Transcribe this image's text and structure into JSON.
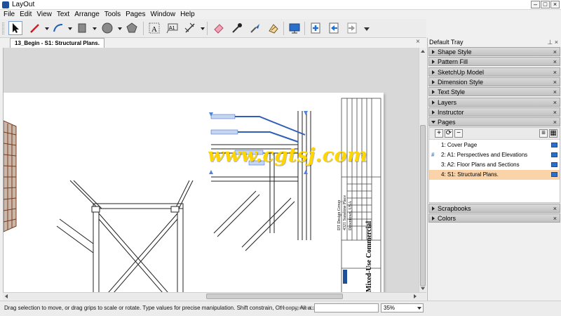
{
  "window": {
    "title": "LayOut"
  },
  "menu": [
    "File",
    "Edit",
    "View",
    "Text",
    "Arrange",
    "Tools",
    "Pages",
    "Window",
    "Help"
  ],
  "document": {
    "tab_label": "13_Begin - S1: Structural Plans.",
    "close_glyph": "×"
  },
  "watermark": "www.cgtsj.com",
  "title_block": {
    "project": "Mixed-Use Commercial",
    "firm": "DT Design Group",
    "address": "4321 Sunshine Place",
    "city": "Downtown, USA"
  },
  "tray": {
    "title": "Default Tray",
    "title_icons": "⊥ ×",
    "panels": [
      {
        "label": "Shape Style",
        "open": false
      },
      {
        "label": "Pattern Fill",
        "open": false
      },
      {
        "label": "SketchUp Model",
        "open": false
      },
      {
        "label": "Dimension Style",
        "open": false
      },
      {
        "label": "Text Style",
        "open": false
      },
      {
        "label": "Layers",
        "open": false
      },
      {
        "label": "Instructor",
        "open": false
      },
      {
        "label": "Pages",
        "open": true
      },
      {
        "label": "Scrapbooks",
        "open": false
      },
      {
        "label": "Colors",
        "open": false
      }
    ],
    "panel_close": "×",
    "pages_tools": [
      "+",
      "⟳",
      "−"
    ],
    "pages": [
      {
        "label": "1:  Cover Page",
        "mark": "",
        "selected": false
      },
      {
        "label": "2:  A1: Perspectives and Elevations",
        "mark": "#",
        "selected": false
      },
      {
        "label": "3:  A2: Floor Plans and Sections",
        "mark": "",
        "selected": false
      },
      {
        "label": "4:  S1: Structural Plans.",
        "mark": "",
        "selected": true
      }
    ]
  },
  "status": {
    "hint": "Drag selection to move, or drag grips to scale or rotate. Type values for precise manipulation. Shift constrain, Ctrl copy, Alt a...",
    "measurements_label": "Measurements",
    "measurements_value": "",
    "zoom": "35%"
  },
  "toolbar_icons": [
    "select-icon",
    "pencil-icon",
    "arc-icon",
    "rectangle-icon",
    "circle-icon",
    "polygon-icon",
    "text-icon",
    "label-icon",
    "dimension-icon",
    "eraser-icon",
    "eyedropper-icon",
    "style-brush-icon",
    "split-icon",
    "presentation-icon",
    "add-page-icon",
    "previous-page-icon",
    "next-page-icon"
  ],
  "colors": {
    "accent": "#3b7bd4",
    "selection": "#fbd3a8",
    "watermark": "#ffd600",
    "annotation": "#2f5fb8"
  }
}
